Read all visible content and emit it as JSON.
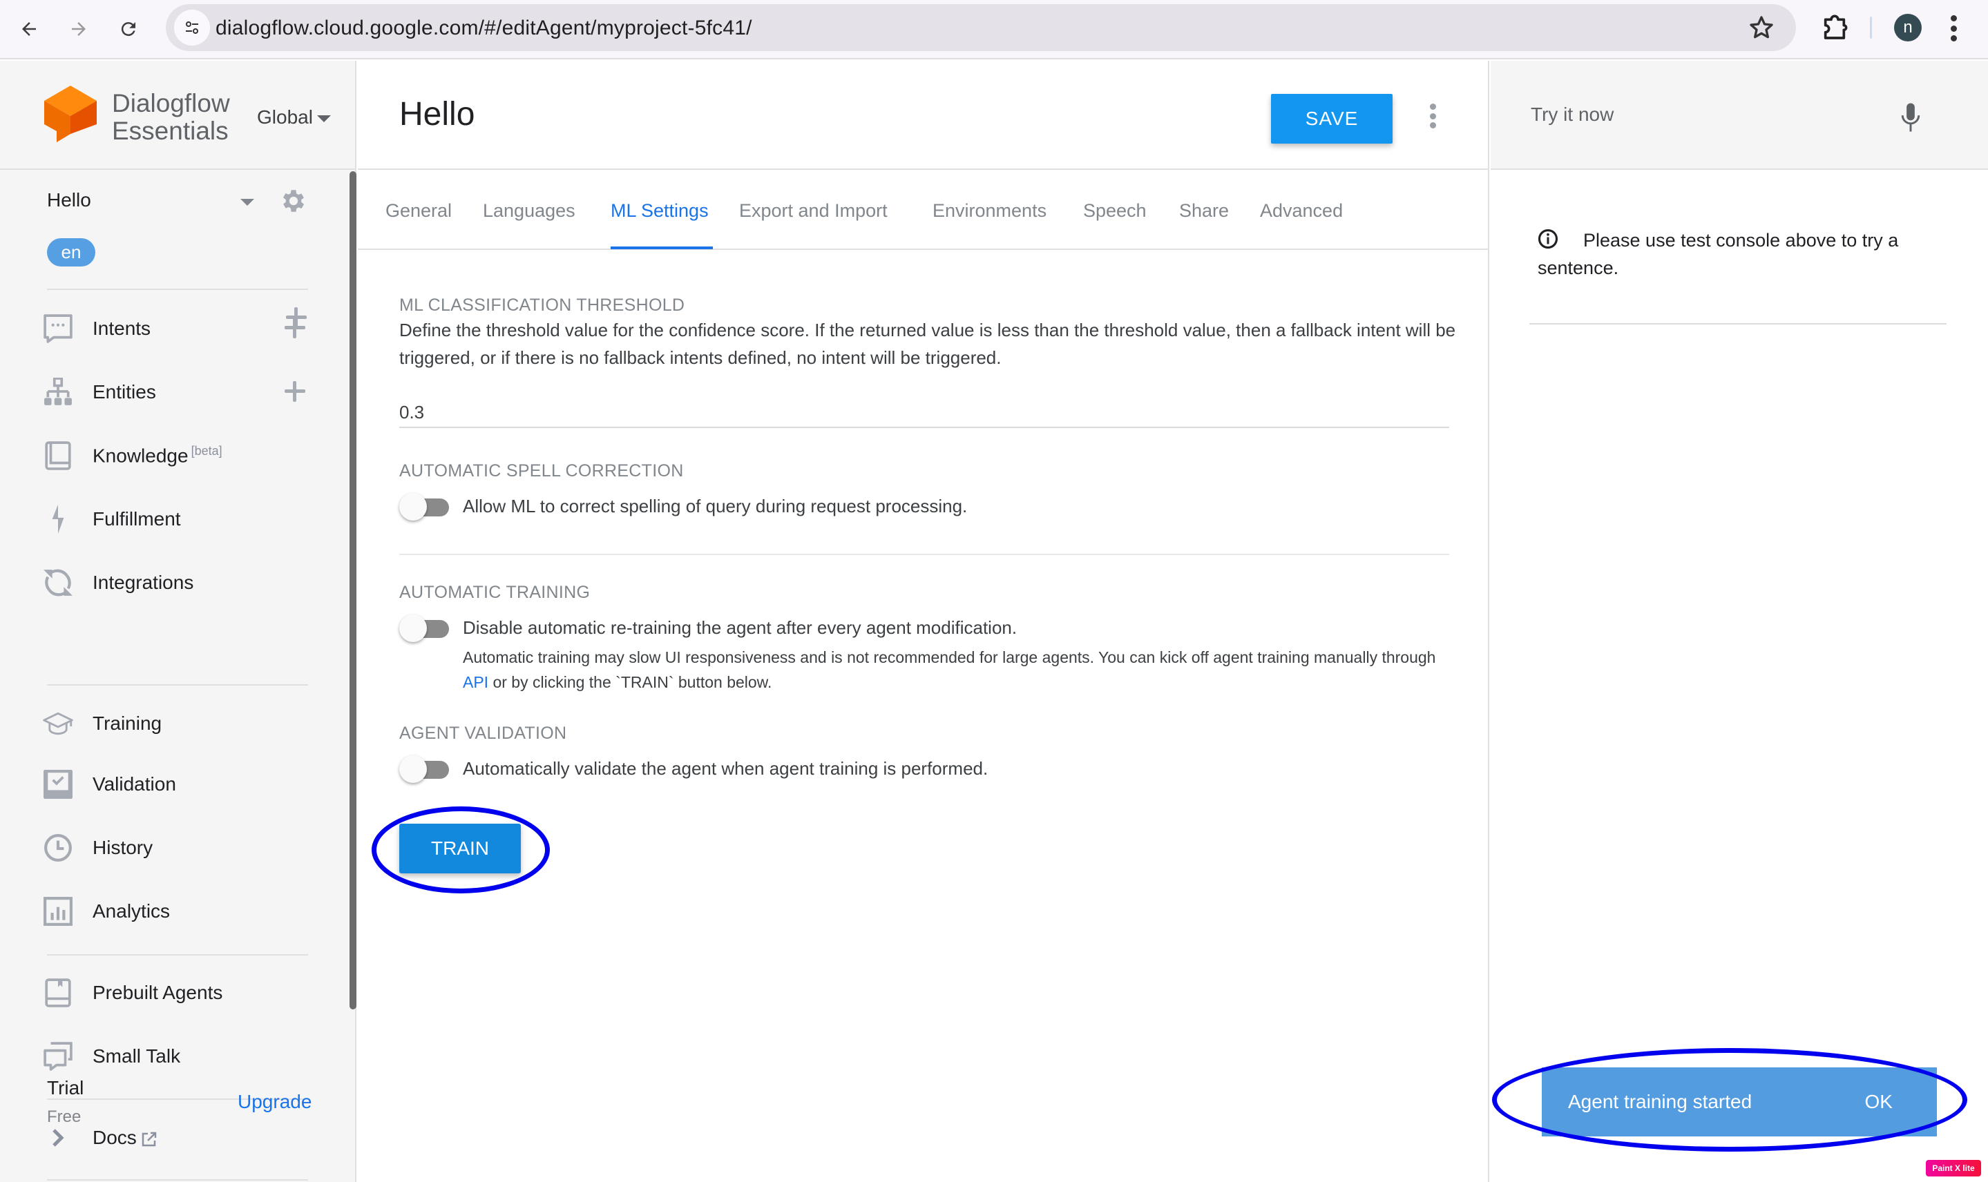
{
  "browser": {
    "url": "dialogflow.cloud.google.com/#/editAgent/myproject-5fc41/",
    "profile_initial": "n"
  },
  "sidebar": {
    "brand_line1": "Dialogflow",
    "brand_line2": "Essentials",
    "region": "Global",
    "agent_name": "Hello",
    "language": "en",
    "items": [
      {
        "label": "Intents",
        "icon": "intents-icon",
        "has_add": true
      },
      {
        "label": "Entities",
        "icon": "entities-icon",
        "has_add": true
      },
      {
        "label": "Knowledge",
        "icon": "knowledge-icon",
        "badge": "[beta]"
      },
      {
        "label": "Fulfillment",
        "icon": "fulfillment-icon"
      },
      {
        "label": "Integrations",
        "icon": "integrations-icon"
      },
      {
        "label": "Training",
        "icon": "training-icon"
      },
      {
        "label": "Validation",
        "icon": "validation-icon"
      },
      {
        "label": "History",
        "icon": "history-icon"
      },
      {
        "label": "Analytics",
        "icon": "analytics-icon"
      },
      {
        "label": "Prebuilt Agents",
        "icon": "prebuilt-agents-icon"
      },
      {
        "label": "Small Talk",
        "icon": "small-talk-icon"
      },
      {
        "label": "Docs",
        "icon": "chevron-right-icon"
      }
    ],
    "plan": "Trial",
    "plan_sub": "Free",
    "upgrade_label": "Upgrade"
  },
  "main": {
    "title": "Hello",
    "save_label": "SAVE",
    "tabs": [
      {
        "label": "General",
        "active": false
      },
      {
        "label": "Languages",
        "active": false
      },
      {
        "label": "ML Settings",
        "active": true
      },
      {
        "label": "Export and Import",
        "active": false
      },
      {
        "label": "Environments",
        "active": false
      },
      {
        "label": "Speech",
        "active": false
      },
      {
        "label": "Share",
        "active": false
      },
      {
        "label": "Advanced",
        "active": false
      }
    ],
    "threshold": {
      "title": "ML CLASSIFICATION THRESHOLD",
      "description": "Define the threshold value for the confidence score. If the returned value is less than the threshold value, then a fallback intent will be triggered, or if there is no fallback intents defined, no intent will be triggered.",
      "value": "0.3"
    },
    "spell": {
      "title": "AUTOMATIC SPELL CORRECTION",
      "label": "Allow ML to correct spelling of query during request processing.",
      "enabled": false
    },
    "auto_training": {
      "title": "AUTOMATIC TRAINING",
      "label": "Disable automatic re-training the agent after every agent modification.",
      "help_before": "Automatic training may slow UI responsiveness and is not recommended for large agents. You can kick off agent training manually through ",
      "help_link": "API",
      "help_after": " or by clicking the `TRAIN` button below.",
      "enabled": false
    },
    "validation": {
      "title": "AGENT VALIDATION",
      "label": "Automatically validate the agent when agent training is performed.",
      "enabled": false
    },
    "train_label": "TRAIN"
  },
  "right": {
    "try_placeholder": "Try it now",
    "info": "Please use test console above to try a sentence.",
    "snackbar_text": "Agent training started",
    "snackbar_action": "OK"
  },
  "watermark": "Paint X lite"
}
